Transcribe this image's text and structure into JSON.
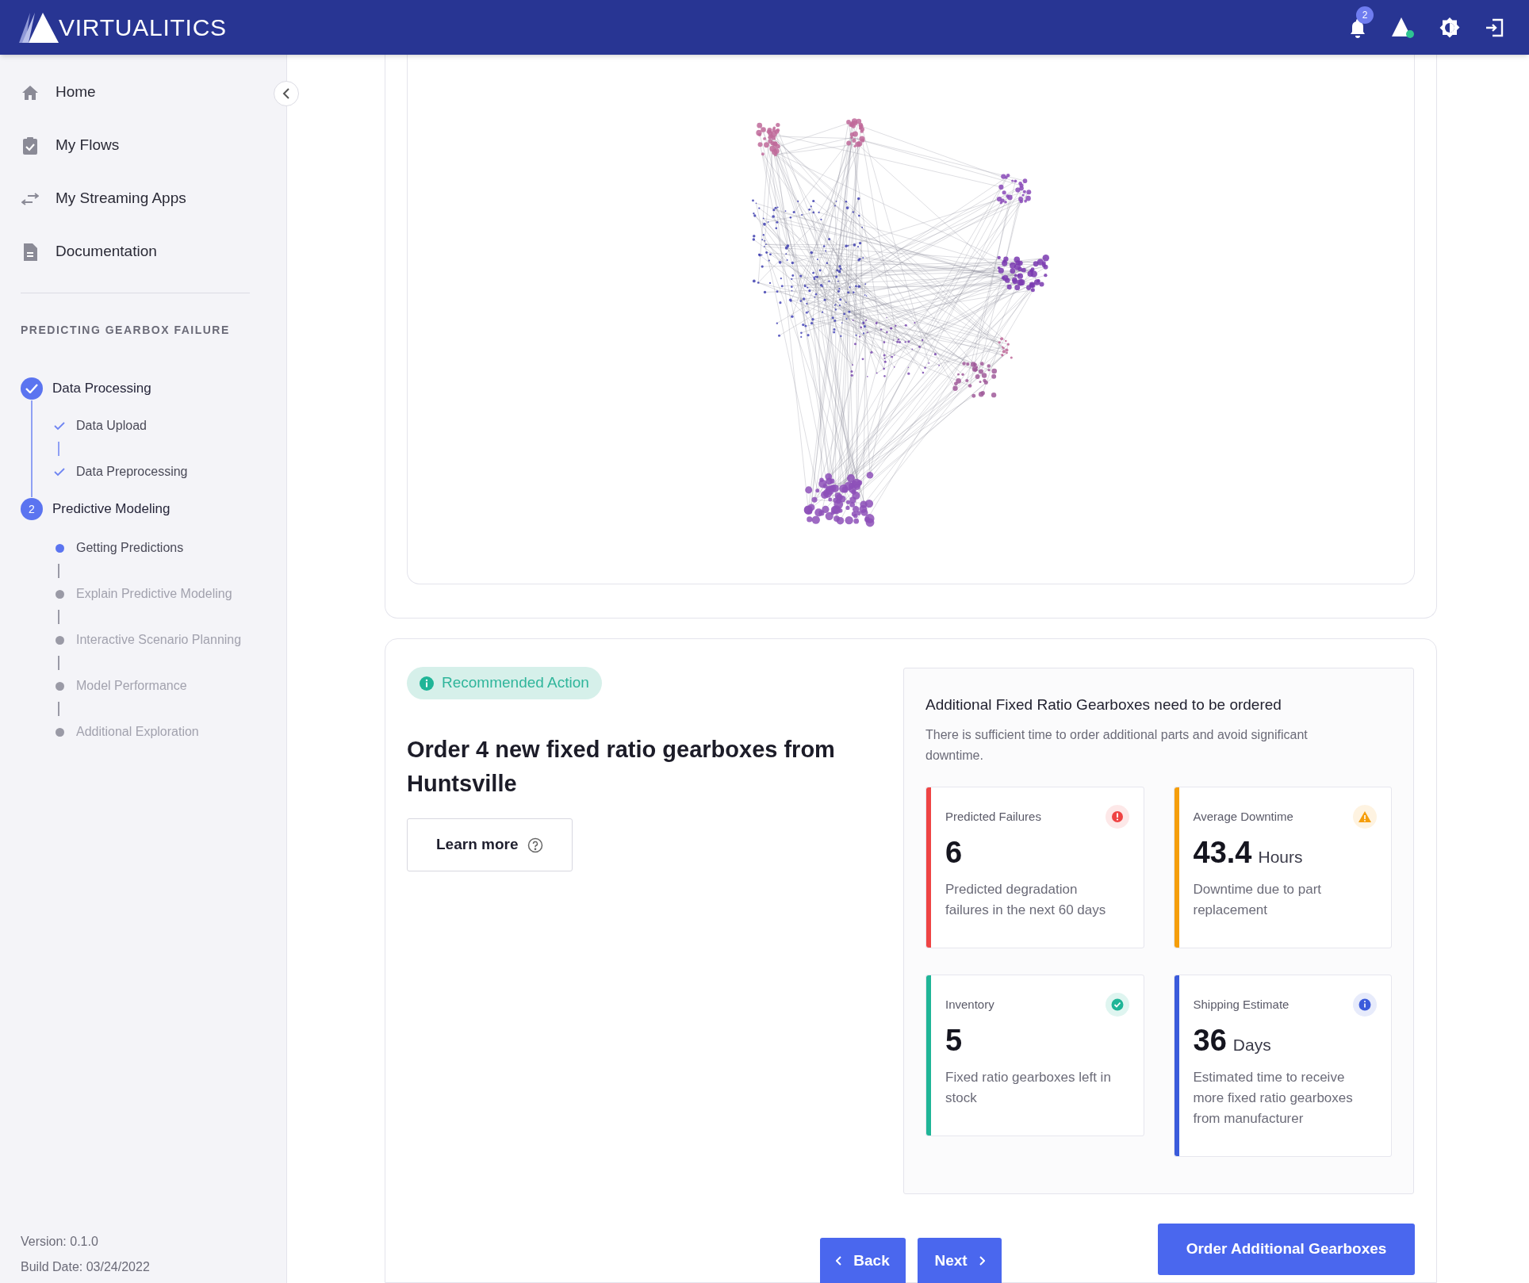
{
  "header": {
    "logo_text": "VIRTUALITICS",
    "notification_count": "2"
  },
  "sidebar": {
    "nav_items": [
      {
        "label": "Home"
      },
      {
        "label": "My Flows"
      },
      {
        "label": "My Streaming Apps"
      },
      {
        "label": "Documentation"
      }
    ],
    "section_title": "PREDICTING GEARBOX FAILURE",
    "steps": [
      {
        "label": "Data Processing",
        "completed": true,
        "children": [
          {
            "label": "Data Upload",
            "completed": true
          },
          {
            "label": "Data Preprocessing",
            "completed": true
          }
        ]
      },
      {
        "label": "Predictive Modeling",
        "number": "2",
        "completed": false,
        "children": [
          {
            "label": "Getting Predictions",
            "completed": false,
            "active": true
          },
          {
            "label": "Explain Predictive Modeling",
            "completed": false,
            "active": false
          },
          {
            "label": "Interactive Scenario Planning",
            "completed": false,
            "active": false
          },
          {
            "label": "Model Performance",
            "completed": false,
            "active": false
          },
          {
            "label": "Additional Exploration",
            "completed": false,
            "active": false
          }
        ]
      }
    ],
    "version": "Version: 0.1.0",
    "build_date": "Build Date: 03/24/2022"
  },
  "recommendation": {
    "badge": "Recommended Action",
    "title": "Order 4 new fixed ratio gearboxes from Huntsville",
    "learn_more": "Learn more"
  },
  "summary": {
    "title": "Additional Fixed Ratio Gearboxes need to be ordered",
    "description": "There is sufficient time to order additional parts and avoid significant downtime.",
    "metrics": [
      {
        "kind": "error",
        "color": "#ef4444",
        "label": "Predicted Failures",
        "value": "6",
        "description": "Predicted degradation failures in the next 60 days"
      },
      {
        "kind": "warning",
        "color": "#f59e0b",
        "label": "Average Downtime",
        "value": "43.4",
        "unit": "Hours",
        "description": "Downtime due to part replacement"
      },
      {
        "kind": "success",
        "color": "#1fb597",
        "label": "Inventory",
        "value": "5",
        "description": "Fixed ratio gearboxes left in stock"
      },
      {
        "kind": "info",
        "color": "#3b5bdb",
        "label": "Shipping Estimate",
        "value": "36",
        "unit": "Days",
        "description": "Estimated time to receive more fixed ratio gearboxes from manufacturer"
      }
    ]
  },
  "buttons": {
    "order": "Order Additional Gearboxes",
    "back": "Back",
    "next": "Next"
  }
}
